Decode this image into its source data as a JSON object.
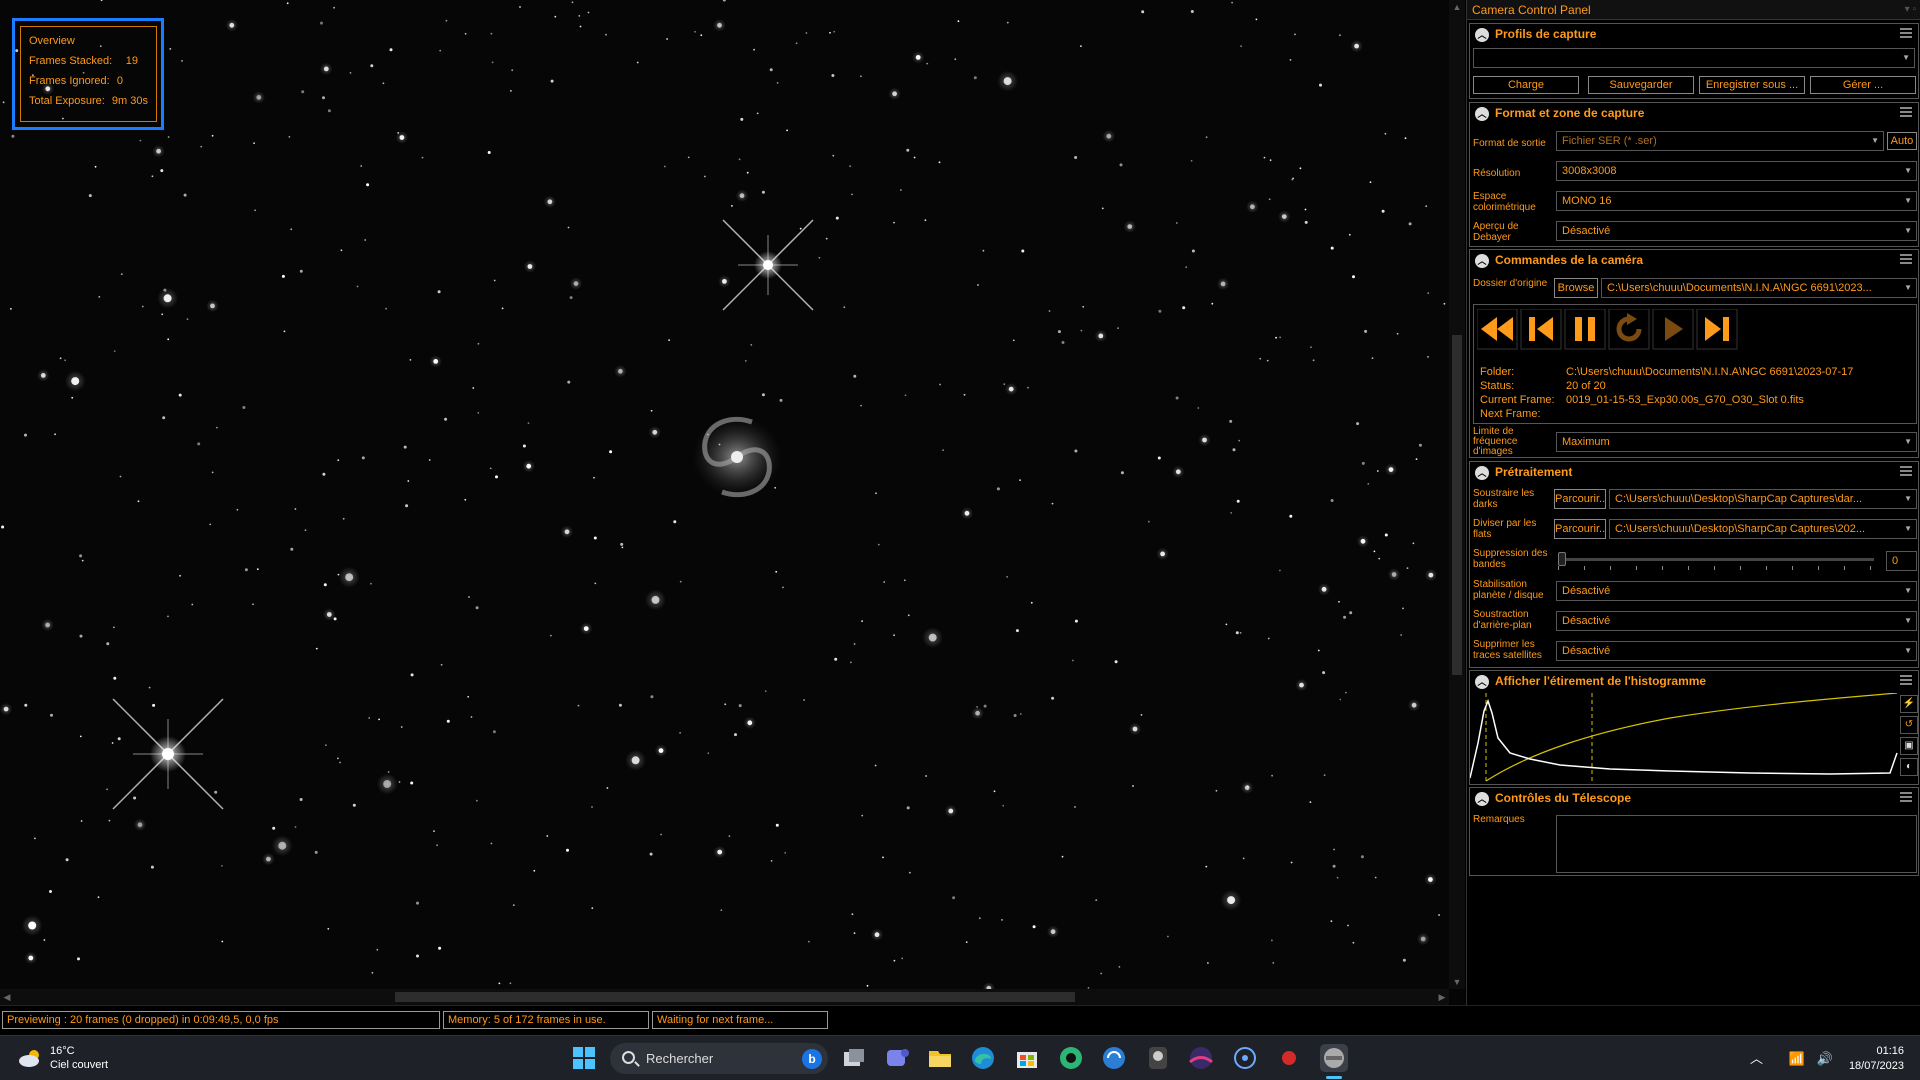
{
  "overview": {
    "title": "Overview",
    "rows": [
      {
        "label": "Frames Stacked:",
        "value": "19"
      },
      {
        "label": "Frames Ignored:",
        "value": "0"
      },
      {
        "label": "Total Exposure:",
        "value": "9m 30s"
      }
    ]
  },
  "statusbar": {
    "preview": "Previewing : 20 frames (0 dropped) in 0:09:49,5, 0,0 fps",
    "memory": "Memory: 5 of 172 frames in use.",
    "waiting": "Waiting for next frame..."
  },
  "panel": {
    "title": "Camera Control Panel",
    "profiles": {
      "title": "Profils de capture",
      "selected": "",
      "buttons": {
        "load": "Charge",
        "save": "Sauvegarder",
        "save_as": "Enregistrer sous ...",
        "manage": "Gérer ..."
      }
    },
    "format": {
      "title": "Format et zone de capture",
      "output_label": "Format de sortie",
      "output_value": "Fichier SER (* .ser)",
      "auto_button": "Auto",
      "resolution_label": "Résolution",
      "resolution_value": "3008x3008",
      "colorspace_label": "Espace colorimétrique",
      "colorspace_value": "MONO 16",
      "debayer_label": "Aperçu de Debayer",
      "debayer_value": "Désactivé"
    },
    "camera": {
      "title": "Commandes de la caméra",
      "folder_label": "Dossier d'origine",
      "browse_button": "Browse",
      "folder_value": "C:\\Users\\chuuu\\Documents\\N.I.N.A\\NGC 6691\\2023...",
      "info": [
        {
          "key": "Folder:",
          "value": "C:\\Users\\chuuu\\Documents\\N.I.N.A\\NGC 6691\\2023-07-17"
        },
        {
          "key": "Status:",
          "value": "20 of 20"
        },
        {
          "key": "Current Frame:",
          "value": "0019_01-15-53_Exp30.00s_G70_O30_Slot 0.fits"
        },
        {
          "key": "Next Frame:",
          "value": ""
        }
      ],
      "framerate_label": "Limite de fréquence d'images",
      "framerate_value": "Maximum"
    },
    "preprocessing": {
      "title": "Prétraitement",
      "darks_label": "Soustraire les darks",
      "darks_button": "Parcourir...",
      "darks_value": "C:\\Users\\chuuu\\Desktop\\SharpCap Captures\\dar...",
      "flats_label": "Diviser par les flats",
      "flats_button": "Parcourir...",
      "flats_value": "C:\\Users\\chuuu\\Desktop\\SharpCap Captures\\202...",
      "banding_label": "Suppression des bandes",
      "banding_value": "0",
      "banding_level": 0,
      "stabilize_label": "Stabilisation planète / disque",
      "stabilize_value": "Désactivé",
      "background_label": "Soustraction d'arrière-plan",
      "background_value": "Désactivé",
      "satellites_label": "Supprimer les traces satellites",
      "satellites_value": "Désactivé"
    },
    "histogram": {
      "title": "Afficher l'étirement de l'histogramme"
    },
    "telescope": {
      "title": "Contrôles du Télescope",
      "notes_label": "Remarques",
      "notes_value": ""
    }
  },
  "taskbar": {
    "weather_temp": "16°C",
    "weather_desc": "Ciel couvert",
    "search_placeholder": "Rechercher",
    "time": "01:16",
    "date": "18/07/2023"
  },
  "colors": {
    "accent": "#ff9a1a",
    "overview_border": "#1a7cff",
    "histogram_curve": "#d4c400"
  }
}
